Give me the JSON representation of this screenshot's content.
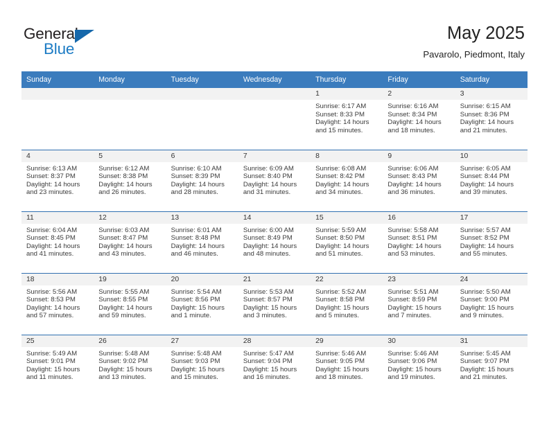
{
  "brand": {
    "name_part1": "General",
    "name_part2": "Blue",
    "accent_color": "#1c7bc4",
    "triangle_color": "#1668ab"
  },
  "header": {
    "title": "May 2025",
    "subtitle": "Pavarolo, Piedmont, Italy"
  },
  "calendar": {
    "header_background": "#3b7cbd",
    "daynum_background": "#f2f2f2",
    "row_border_color": "#2f6fb0",
    "columns": [
      "Sunday",
      "Monday",
      "Tuesday",
      "Wednesday",
      "Thursday",
      "Friday",
      "Saturday"
    ],
    "weeks": [
      [
        {
          "day": "",
          "empty": true
        },
        {
          "day": "",
          "empty": true
        },
        {
          "day": "",
          "empty": true
        },
        {
          "day": "",
          "empty": true
        },
        {
          "day": "1",
          "sunrise": "Sunrise: 6:17 AM",
          "sunset": "Sunset: 8:33 PM",
          "daylight1": "Daylight: 14 hours",
          "daylight2": "and 15 minutes."
        },
        {
          "day": "2",
          "sunrise": "Sunrise: 6:16 AM",
          "sunset": "Sunset: 8:34 PM",
          "daylight1": "Daylight: 14 hours",
          "daylight2": "and 18 minutes."
        },
        {
          "day": "3",
          "sunrise": "Sunrise: 6:15 AM",
          "sunset": "Sunset: 8:36 PM",
          "daylight1": "Daylight: 14 hours",
          "daylight2": "and 21 minutes."
        }
      ],
      [
        {
          "day": "4",
          "sunrise": "Sunrise: 6:13 AM",
          "sunset": "Sunset: 8:37 PM",
          "daylight1": "Daylight: 14 hours",
          "daylight2": "and 23 minutes."
        },
        {
          "day": "5",
          "sunrise": "Sunrise: 6:12 AM",
          "sunset": "Sunset: 8:38 PM",
          "daylight1": "Daylight: 14 hours",
          "daylight2": "and 26 minutes."
        },
        {
          "day": "6",
          "sunrise": "Sunrise: 6:10 AM",
          "sunset": "Sunset: 8:39 PM",
          "daylight1": "Daylight: 14 hours",
          "daylight2": "and 28 minutes."
        },
        {
          "day": "7",
          "sunrise": "Sunrise: 6:09 AM",
          "sunset": "Sunset: 8:40 PM",
          "daylight1": "Daylight: 14 hours",
          "daylight2": "and 31 minutes."
        },
        {
          "day": "8",
          "sunrise": "Sunrise: 6:08 AM",
          "sunset": "Sunset: 8:42 PM",
          "daylight1": "Daylight: 14 hours",
          "daylight2": "and 34 minutes."
        },
        {
          "day": "9",
          "sunrise": "Sunrise: 6:06 AM",
          "sunset": "Sunset: 8:43 PM",
          "daylight1": "Daylight: 14 hours",
          "daylight2": "and 36 minutes."
        },
        {
          "day": "10",
          "sunrise": "Sunrise: 6:05 AM",
          "sunset": "Sunset: 8:44 PM",
          "daylight1": "Daylight: 14 hours",
          "daylight2": "and 39 minutes."
        }
      ],
      [
        {
          "day": "11",
          "sunrise": "Sunrise: 6:04 AM",
          "sunset": "Sunset: 8:45 PM",
          "daylight1": "Daylight: 14 hours",
          "daylight2": "and 41 minutes."
        },
        {
          "day": "12",
          "sunrise": "Sunrise: 6:03 AM",
          "sunset": "Sunset: 8:47 PM",
          "daylight1": "Daylight: 14 hours",
          "daylight2": "and 43 minutes."
        },
        {
          "day": "13",
          "sunrise": "Sunrise: 6:01 AM",
          "sunset": "Sunset: 8:48 PM",
          "daylight1": "Daylight: 14 hours",
          "daylight2": "and 46 minutes."
        },
        {
          "day": "14",
          "sunrise": "Sunrise: 6:00 AM",
          "sunset": "Sunset: 8:49 PM",
          "daylight1": "Daylight: 14 hours",
          "daylight2": "and 48 minutes."
        },
        {
          "day": "15",
          "sunrise": "Sunrise: 5:59 AM",
          "sunset": "Sunset: 8:50 PM",
          "daylight1": "Daylight: 14 hours",
          "daylight2": "and 51 minutes."
        },
        {
          "day": "16",
          "sunrise": "Sunrise: 5:58 AM",
          "sunset": "Sunset: 8:51 PM",
          "daylight1": "Daylight: 14 hours",
          "daylight2": "and 53 minutes."
        },
        {
          "day": "17",
          "sunrise": "Sunrise: 5:57 AM",
          "sunset": "Sunset: 8:52 PM",
          "daylight1": "Daylight: 14 hours",
          "daylight2": "and 55 minutes."
        }
      ],
      [
        {
          "day": "18",
          "sunrise": "Sunrise: 5:56 AM",
          "sunset": "Sunset: 8:53 PM",
          "daylight1": "Daylight: 14 hours",
          "daylight2": "and 57 minutes."
        },
        {
          "day": "19",
          "sunrise": "Sunrise: 5:55 AM",
          "sunset": "Sunset: 8:55 PM",
          "daylight1": "Daylight: 14 hours",
          "daylight2": "and 59 minutes."
        },
        {
          "day": "20",
          "sunrise": "Sunrise: 5:54 AM",
          "sunset": "Sunset: 8:56 PM",
          "daylight1": "Daylight: 15 hours",
          "daylight2": "and 1 minute."
        },
        {
          "day": "21",
          "sunrise": "Sunrise: 5:53 AM",
          "sunset": "Sunset: 8:57 PM",
          "daylight1": "Daylight: 15 hours",
          "daylight2": "and 3 minutes."
        },
        {
          "day": "22",
          "sunrise": "Sunrise: 5:52 AM",
          "sunset": "Sunset: 8:58 PM",
          "daylight1": "Daylight: 15 hours",
          "daylight2": "and 5 minutes."
        },
        {
          "day": "23",
          "sunrise": "Sunrise: 5:51 AM",
          "sunset": "Sunset: 8:59 PM",
          "daylight1": "Daylight: 15 hours",
          "daylight2": "and 7 minutes."
        },
        {
          "day": "24",
          "sunrise": "Sunrise: 5:50 AM",
          "sunset": "Sunset: 9:00 PM",
          "daylight1": "Daylight: 15 hours",
          "daylight2": "and 9 minutes."
        }
      ],
      [
        {
          "day": "25",
          "sunrise": "Sunrise: 5:49 AM",
          "sunset": "Sunset: 9:01 PM",
          "daylight1": "Daylight: 15 hours",
          "daylight2": "and 11 minutes."
        },
        {
          "day": "26",
          "sunrise": "Sunrise: 5:48 AM",
          "sunset": "Sunset: 9:02 PM",
          "daylight1": "Daylight: 15 hours",
          "daylight2": "and 13 minutes."
        },
        {
          "day": "27",
          "sunrise": "Sunrise: 5:48 AM",
          "sunset": "Sunset: 9:03 PM",
          "daylight1": "Daylight: 15 hours",
          "daylight2": "and 15 minutes."
        },
        {
          "day": "28",
          "sunrise": "Sunrise: 5:47 AM",
          "sunset": "Sunset: 9:04 PM",
          "daylight1": "Daylight: 15 hours",
          "daylight2": "and 16 minutes."
        },
        {
          "day": "29",
          "sunrise": "Sunrise: 5:46 AM",
          "sunset": "Sunset: 9:05 PM",
          "daylight1": "Daylight: 15 hours",
          "daylight2": "and 18 minutes."
        },
        {
          "day": "30",
          "sunrise": "Sunrise: 5:46 AM",
          "sunset": "Sunset: 9:06 PM",
          "daylight1": "Daylight: 15 hours",
          "daylight2": "and 19 minutes."
        },
        {
          "day": "31",
          "sunrise": "Sunrise: 5:45 AM",
          "sunset": "Sunset: 9:07 PM",
          "daylight1": "Daylight: 15 hours",
          "daylight2": "and 21 minutes."
        }
      ]
    ]
  }
}
